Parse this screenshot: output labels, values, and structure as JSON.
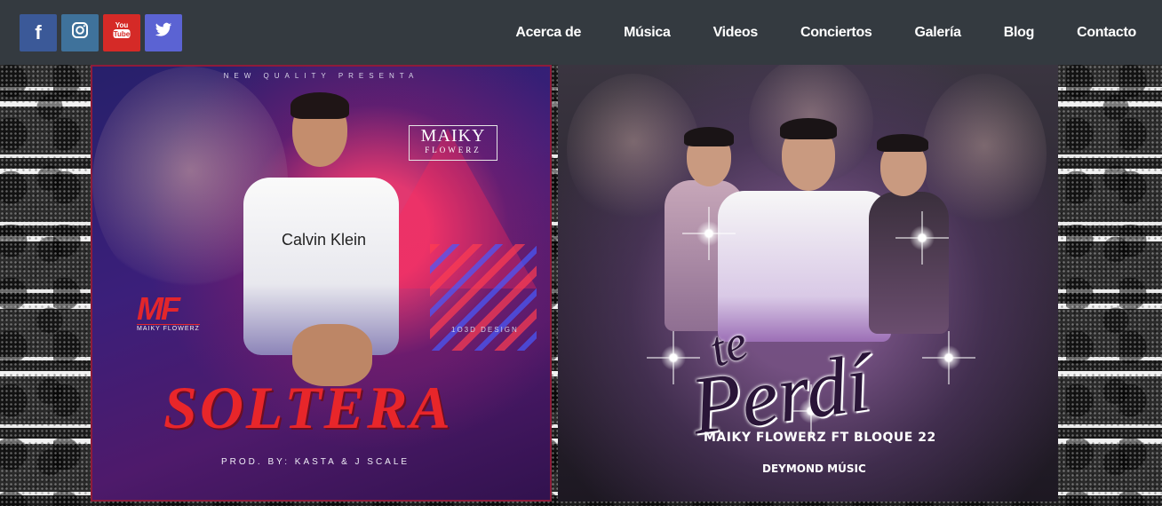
{
  "social": [
    {
      "name": "facebook",
      "icon": "facebook-icon",
      "glyph": "f",
      "color": "#3b5998"
    },
    {
      "name": "instagram",
      "icon": "instagram-icon",
      "glyph": "◎",
      "color": "#3f729b"
    },
    {
      "name": "youtube",
      "icon": "youtube-icon",
      "glyph": "You Tube",
      "color": "#d52a27"
    },
    {
      "name": "twitter",
      "icon": "twitter-icon",
      "glyph": "🐦",
      "color": "#5b63d3"
    }
  ],
  "nav": {
    "items": [
      "Acerca de",
      "Música",
      "Videos",
      "Conciertos",
      "Galería",
      "Blog",
      "Contacto"
    ]
  },
  "covers": {
    "left": {
      "presenta": "NEW QUALITY PRESENTA",
      "artist_box_line1": "MAIKY",
      "artist_box_line2": "FLOWERZ",
      "logo": "MF",
      "logo_sub": "MAIKY FLOWERZ",
      "shirt_brand": "Calvin Klein",
      "design_credit": "1O3D DESIGN",
      "title": "SOLTERA",
      "producer": "PROD. BY: KASTA & J SCALE"
    },
    "right": {
      "title_small": "te",
      "title_large": "Perdí",
      "featuring": "MAIKY FLOWERZ FT BLOQUE 22",
      "label": "DEYMOND MÚSIC"
    }
  }
}
